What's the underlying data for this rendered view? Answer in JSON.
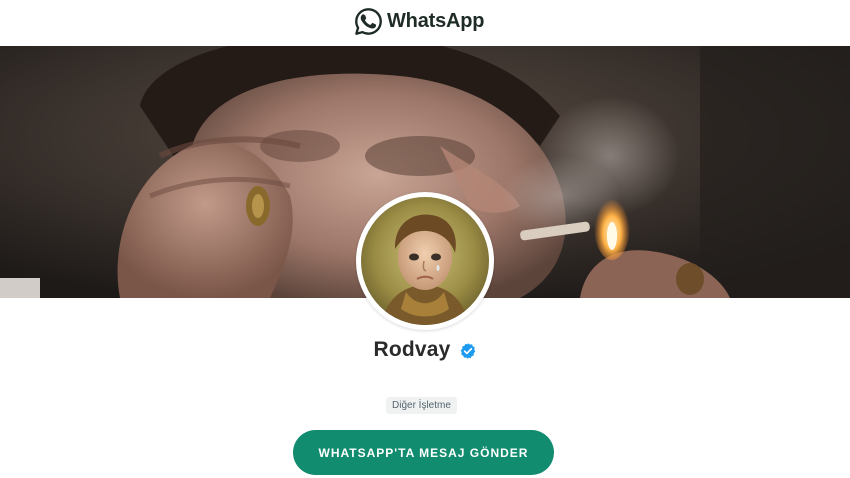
{
  "header": {
    "brand_name": "WhatsApp",
    "brand_icon": "whatsapp-logo-icon"
  },
  "cover": {
    "image_description_icon": "cover-photo"
  },
  "profile": {
    "name": "Rodvay",
    "verified_icon": "verified-badge-icon",
    "category": "Diğer İşletme"
  },
  "actions": {
    "send_message_label": "WHATSAPP'TA MESAJ GÖNDER"
  },
  "colors": {
    "brand_text": "#1f2c26",
    "button_bg": "#128c6e",
    "verified_blue": "#1d9bf0",
    "badge_bg": "#f0f2f2"
  }
}
